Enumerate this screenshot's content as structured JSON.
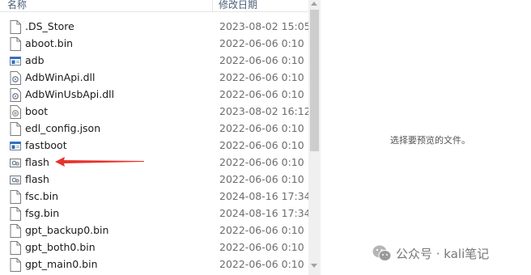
{
  "header": {
    "name_col": "名称",
    "date_col": "修改日期"
  },
  "files": [
    {
      "name": ".DS_Store",
      "date": "2023-08-02 15:05",
      "icon": "file-icon"
    },
    {
      "name": "aboot.bin",
      "date": "2022-06-06 0:10",
      "icon": "file-icon"
    },
    {
      "name": "adb",
      "date": "2022-06-06 0:10",
      "icon": "exe-icon"
    },
    {
      "name": "AdbWinApi.dll",
      "date": "2022-06-06 0:10",
      "icon": "dll-icon"
    },
    {
      "name": "AdbWinUsbApi.dll",
      "date": "2022-06-06 0:10",
      "icon": "dll-icon"
    },
    {
      "name": "boot",
      "date": "2023-08-02 16:12",
      "icon": "disc-file-icon"
    },
    {
      "name": "edl_config.json",
      "date": "2022-06-06 0:10",
      "icon": "file-icon"
    },
    {
      "name": "fastboot",
      "date": "2022-06-06 0:10",
      "icon": "exe-icon"
    },
    {
      "name": "flash",
      "date": "2022-06-06 0:10",
      "icon": "batch-icon"
    },
    {
      "name": "flash",
      "date": "2022-06-06 0:10",
      "icon": "batch-icon"
    },
    {
      "name": "fsc.bin",
      "date": "2024-08-16 17:34",
      "icon": "file-icon"
    },
    {
      "name": "fsg.bin",
      "date": "2024-08-16 17:34",
      "icon": "file-icon"
    },
    {
      "name": "gpt_backup0.bin",
      "date": "2022-06-06 0:10",
      "icon": "file-icon"
    },
    {
      "name": "gpt_both0.bin",
      "date": "2022-06-06 0:10",
      "icon": "file-icon"
    },
    {
      "name": "gpt_main0.bin",
      "date": "2022-06-06 0:10",
      "icon": "file-icon"
    }
  ],
  "preview": {
    "message": "选择要预览的文件。"
  },
  "watermark": {
    "text": "公众号 · kali笔记"
  },
  "colors": {
    "arrow": "#e8322b",
    "exe_blue": "#2b6cc4"
  }
}
